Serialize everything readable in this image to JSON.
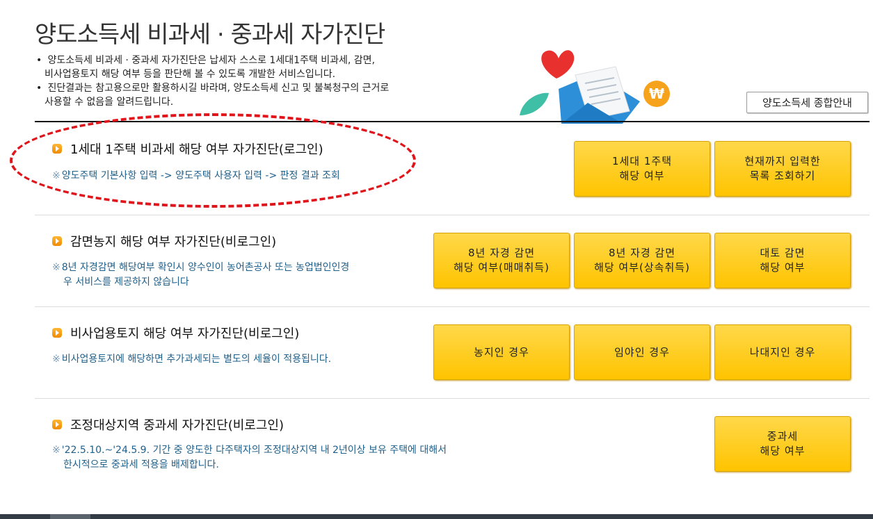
{
  "page": {
    "title": "양도소득세 비과세 · 중과세 자가진단",
    "intro": [
      "양도소득세 비과세 · 중과세 자가진단은 납세자 스스로 1세대1주택 비과세, 감면,",
      "비사업용토지 해당 여부 등을 판단해 볼 수 있도록 개발한 서비스입니다.",
      "진단결과는 참고용으로만 활용하시길 바라며, 양도소득세 신고 및 불복청구의 근거로",
      "사용할 수 없음을 알려드립니다."
    ],
    "guide_button": "양도소득세 종합안내"
  },
  "sections": [
    {
      "heading": "1세대 1주택 비과세 해당 여부 자가진단(로그인)",
      "note": "양도주택 기본사항 입력 -> 양도주택 사용자 입력 -> 판정 결과 조회",
      "note_mark": "※",
      "buttons": [
        "1세대 1주택\n해당 여부",
        "현재까지 입력한\n목록 조회하기"
      ]
    },
    {
      "heading": "감면농지 해당 여부 자가진단(비로그인)",
      "note": "8년 자경감면 해당여부 확인시 양수인이 농어촌공사 또는 농업법인인경",
      "note_line2": "우 서비스를 제공하지 않습니다",
      "note_mark": "※",
      "buttons": [
        "8년 자경 감면\n해당 여부(매매취득)",
        "8년 자경 감면\n해당 여부(상속취득)",
        "대토 감면\n해당 여부"
      ]
    },
    {
      "heading": "비사업용토지 해당 여부 자가진단(비로그인)",
      "note": "비사업용토지에 해당하면 추가과세되는 별도의 세율이 적용됩니다.",
      "note_mark": "※",
      "buttons": [
        "농지인 경우",
        "임야인 경우",
        "나대지인 경우"
      ]
    },
    {
      "heading": "조정대상지역 중과세 자가진단(비로그인)",
      "note": "'22.5.10.~'24.5.9. 기간 중 양도한 다주택자의 조정대상지역 내 2년이상 보유 주택에 대해서",
      "note_line2": "한시적으로 중과세 적용을 배제합니다.",
      "note_mark": "※",
      "buttons": [
        "중과세\n해당 여부"
      ]
    }
  ],
  "colors": {
    "button_yellow": "#ffc400",
    "heading_icon": "#f08a00",
    "note_text": "#1f5f8a",
    "highlight_red": "#e0141b"
  },
  "icons": [
    "heart-icon",
    "envelope-icon",
    "won-coin-icon",
    "leaf-icon",
    "arrow-bullet-icon"
  ]
}
